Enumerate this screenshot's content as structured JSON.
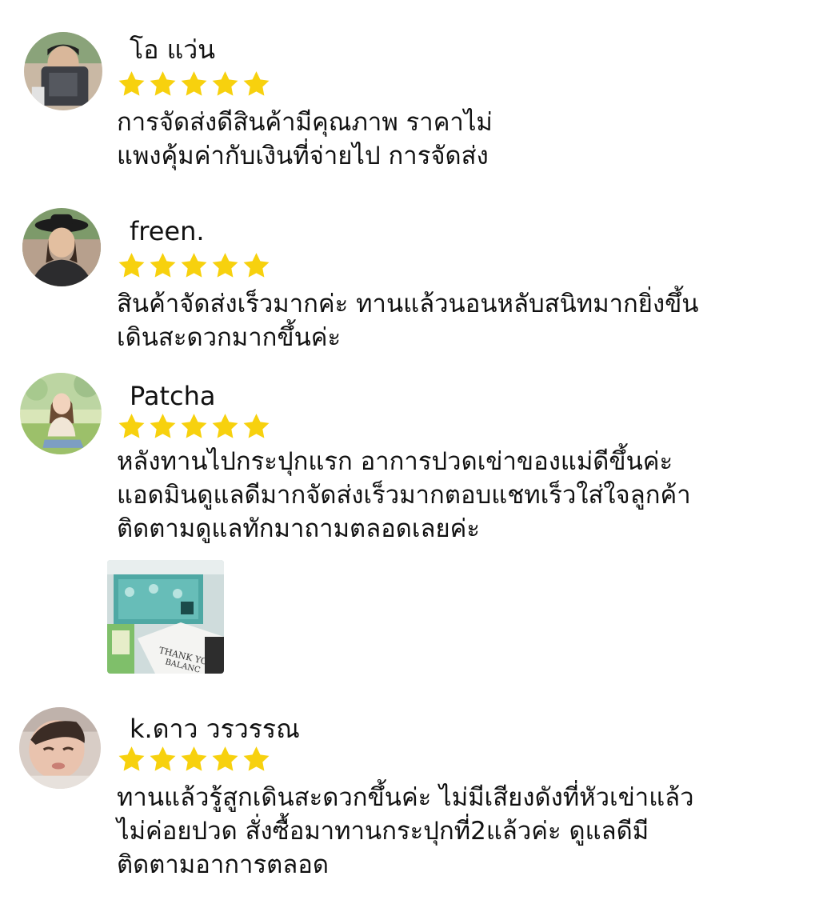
{
  "reviews": [
    {
      "name": "โอ แว่น",
      "rating": 5,
      "text": "การจัดส่งดีสินค้ามีคุณภาพ ราคาไม่\nแพงคุ้มค่ากับเงินที่จ่ายไป การจัดส่ง"
    },
    {
      "name": "freen.",
      "rating": 5,
      "text": "สินค้าจัดส่งเร็วมากค่ะ ทานแล้วนอนหลับสนิทมากยิ่งขึ้น\nเดินสะดวกมากขึ้นค่ะ"
    },
    {
      "name": "Patcha",
      "rating": 5,
      "text": "หลังทานไปกระปุกแรก อาการปวดเข่าของแม่ดีขึ้นค่ะ\nแอดมินดูแลดีมากจัดส่งเร็วมากตอบแชทเร็วใส่ใจลูกค้า\nติดตามดูแลทักมาถามตลอดเลยค่ะ",
      "photo_text": [
        "THANK YOU",
        "BALANC"
      ]
    },
    {
      "name": "k.ดาว วรวรรณ",
      "rating": 5,
      "text": "ทานแล้วรู้สูกเดินสะดวกขึ้นค่ะ ไม่มีเสียงดังที่หัวเข่าแล้ว\nไม่ค่อยปวด สั่งซื้อมาทานกระปุกที่2แล้วค่ะ ดูแลดีมี\nติดตามอาการตลอด"
    }
  ],
  "colors": {
    "star": "#F7D10E",
    "text": "#111111",
    "background": "#FFFFFF"
  },
  "icons": {
    "rating": "star-icon"
  }
}
